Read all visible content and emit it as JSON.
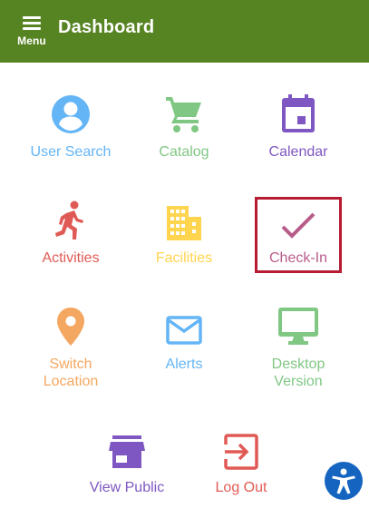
{
  "header": {
    "title": "Dashboard",
    "menu_label": "Menu",
    "background": "#578422"
  },
  "tiles": [
    {
      "label": "User Search",
      "icon": "account-circle-icon",
      "color": "#64b5f6"
    },
    {
      "label": "Catalog",
      "icon": "shopping-cart-icon",
      "color": "#81c784"
    },
    {
      "label": "Calendar",
      "icon": "calendar-icon",
      "color": "#7e57c2"
    },
    {
      "label": "Activities",
      "icon": "running-person-icon",
      "color": "#e05a55"
    },
    {
      "label": "Facilities",
      "icon": "building-icon",
      "color": "#ffd54f"
    },
    {
      "label": "Check-In",
      "icon": "checkmark-icon",
      "color": "#b85c8a",
      "selected": true
    },
    {
      "label": "Switch\nLocation",
      "line1": "Switch",
      "line2": "Location",
      "icon": "location-pin-icon",
      "color": "#f4a760"
    },
    {
      "label": "Alerts",
      "icon": "envelope-icon",
      "color": "#64b5f6"
    },
    {
      "label": "Desktop\nVersion",
      "line1": "Desktop",
      "line2": "Version",
      "icon": "monitor-icon",
      "color": "#81c784"
    },
    {
      "label": "View Public",
      "icon": "storefront-icon",
      "color": "#7e57c2"
    },
    {
      "label": "Log Out",
      "icon": "exit-icon",
      "color": "#e05a55"
    }
  ],
  "selection_color": "#b71c34",
  "accessibility": {
    "icon": "accessibility-icon",
    "color": "#1565c0"
  }
}
